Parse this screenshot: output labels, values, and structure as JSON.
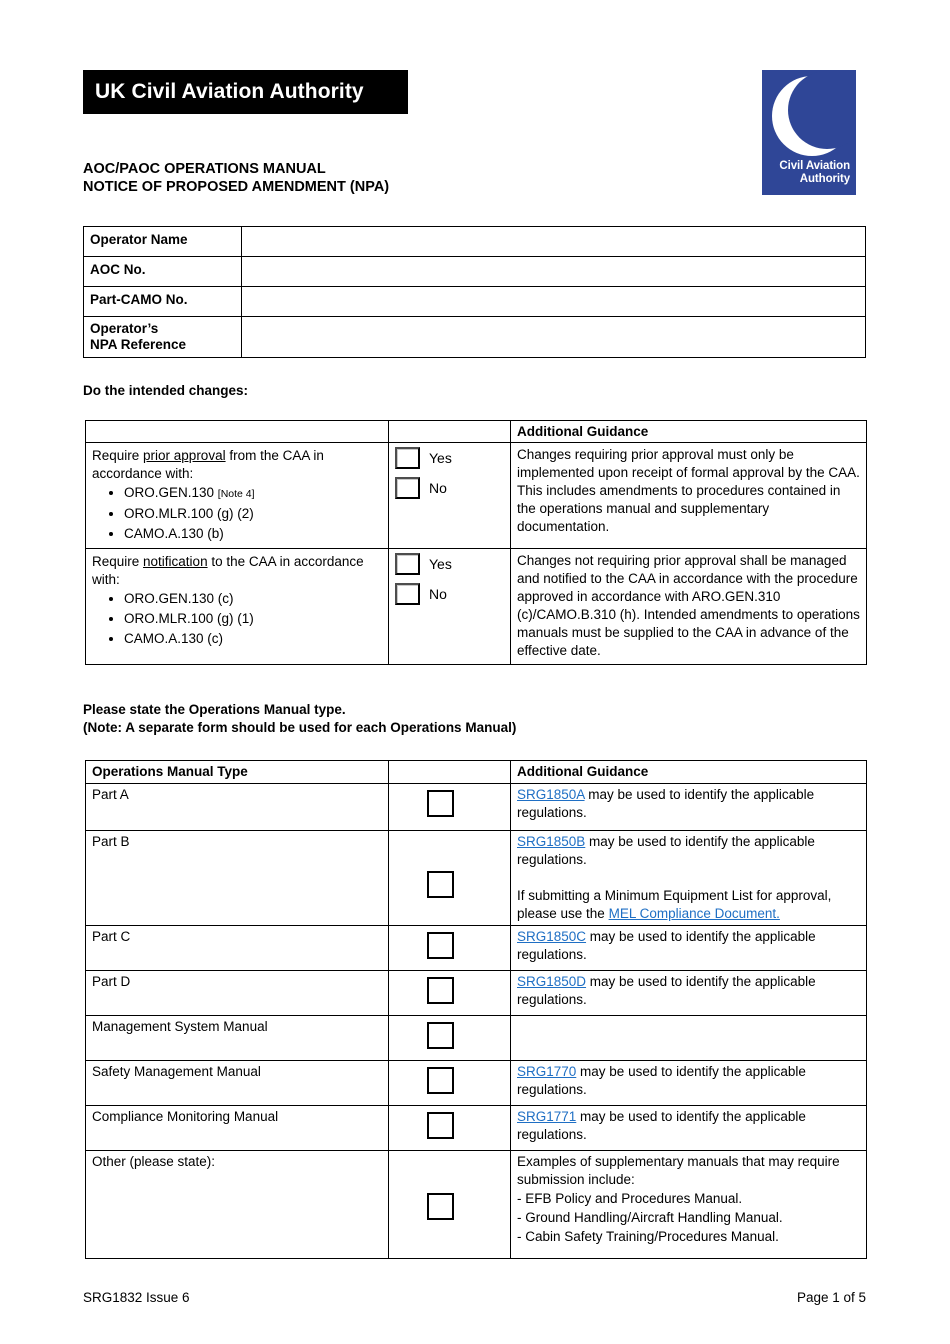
{
  "header": {
    "brand_band": "UK Civil Aviation Authority",
    "logo_line1": "Civil Aviation",
    "logo_line2": "Authority",
    "logo_color": "#2F4697",
    "band_color": "#000000"
  },
  "document": {
    "title": "AOC/PAOC OPERATIONS MANUAL\nNOTICE OF PROPOSED AMENDMENT (NPA)",
    "footer_left": "SRG1832 Issue 6",
    "footer_right": "Page 1 of 5",
    "link_color": "#1F6FC4"
  },
  "operator_table": {
    "rows": [
      {
        "label": "Operator Name",
        "value": ""
      },
      {
        "label": "AOC No.",
        "value": ""
      },
      {
        "label": "Part-CAMO No.",
        "value": ""
      },
      {
        "label": "Operator’s\nNPA Reference",
        "value": ""
      }
    ]
  },
  "changes_section": {
    "prompt": "Do the intended changes:",
    "header_blank": "",
    "header_checkbox_blank": "",
    "header_guidance": "Additional Guidance",
    "rows": [
      {
        "lead_before": "Require ",
        "lead_underlined": "prior approval",
        "lead_after": " from the CAA in accordance with:",
        "bullets": [
          {
            "text": "ORO.GEN.130",
            "note": "[Note 4]"
          },
          {
            "text": "ORO.MLR.100 (g) (2)",
            "note": ""
          },
          {
            "text": "CAMO.A.130 (b)",
            "note": ""
          }
        ],
        "options": [
          "Yes",
          "No"
        ],
        "guidance": "Changes requiring prior approval must only be implemented upon receipt of formal approval by the CAA. This includes amendments to procedures contained in the operations manual and supplementary documentation."
      },
      {
        "lead_before": "Require ",
        "lead_underlined": "notification",
        "lead_after": " to the CAA in accordance with:",
        "bullets": [
          {
            "text": "ORO.GEN.130 (c)",
            "note": ""
          },
          {
            "text": "ORO.MLR.100 (g) (1)",
            "note": ""
          },
          {
            "text": "CAMO.A.130 (c)",
            "note": ""
          }
        ],
        "options": [
          "Yes",
          "No"
        ],
        "guidance": "Changes not requiring prior approval shall be managed and notified to the CAA in accordance with the procedure approved in accordance with ARO.GEN.310 (c)/CAMO.B.310 (h). Intended amendments to operations manuals must be supplied to the CAA in advance of the effective date."
      }
    ]
  },
  "manual_section": {
    "prompt": "Please state the Operations Manual type.\n(Note: A separate form should be used for each Operations Manual)",
    "columns": {
      "type": "Operations Manual Type",
      "checkbox": "",
      "guidance": "Additional Guidance"
    },
    "rows": [
      {
        "type": "Part A",
        "guidance_link": "SRG1850A",
        "guidance_text": " may be used to identify the applicable regulations."
      },
      {
        "type": "Part B",
        "guidance_link": "SRG1850B",
        "guidance_text": " may be used to identify the applicable regulations.",
        "extra_text_before": "If submitting a Minimum Equipment List for approval, please use the ",
        "extra_link": "MEL Compliance Document.",
        "extra_text_after": ""
      },
      {
        "type": "Part C",
        "guidance_link": "SRG1850C",
        "guidance_text": " may be used to identify the applicable regulations."
      },
      {
        "type": "Part D",
        "guidance_link": "SRG1850D",
        "guidance_text": " may be used to identify the applicable regulations."
      },
      {
        "type": "Management System Manual",
        "guidance_link": "",
        "guidance_text": ""
      },
      {
        "type": "Safety Management Manual",
        "guidance_link": "SRG1770",
        "guidance_text": " may be used to identify the applicable regulations."
      },
      {
        "type": "Compliance Monitoring Manual",
        "guidance_link": "SRG1771",
        "guidance_text": " may be used to identify the applicable regulations."
      },
      {
        "type": "Other (please state):",
        "guidance_link": "",
        "guidance_text": "Examples of supplementary manuals that may require submission include:",
        "guidance_items": [
          "-  EFB Policy and Procedures Manual.",
          "-  Ground Handling/Aircraft Handling Manual.",
          "-  Cabin Safety Training/Procedures Manual."
        ]
      }
    ]
  }
}
